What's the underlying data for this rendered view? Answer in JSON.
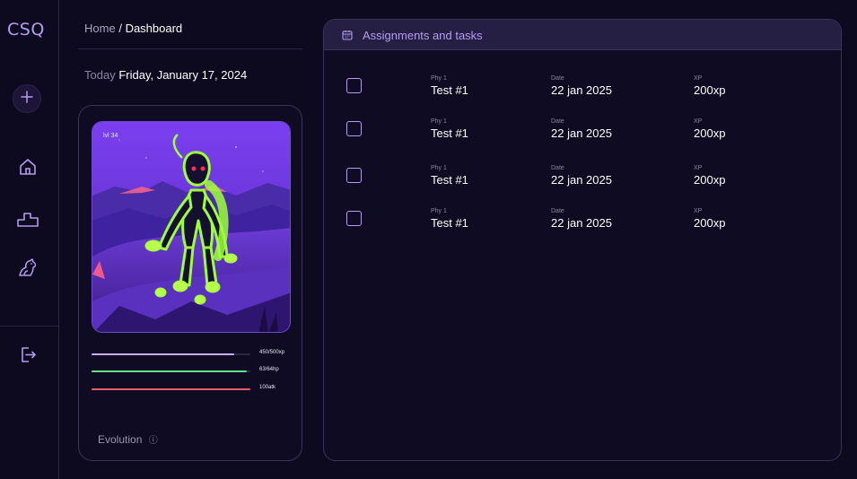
{
  "app": {
    "logo": "CSQ"
  },
  "sidebar": {
    "items": [
      {
        "icon": "plus-icon"
      },
      {
        "icon": "home-icon"
      },
      {
        "icon": "podium-icon"
      },
      {
        "icon": "pet-icon"
      },
      {
        "icon": "logout-icon"
      }
    ]
  },
  "breadcrumb": {
    "home": "Home",
    "separator": "/",
    "current": "Dashboard"
  },
  "today": {
    "label": "Today",
    "value": "Friday, January 17, 2024"
  },
  "pet": {
    "level": "lvl 34",
    "stats": [
      {
        "label": "450/500xp",
        "fraction": 0.9,
        "color": "#c9aef5"
      },
      {
        "label": "63/64hp",
        "fraction": 0.98,
        "color": "#6be08a"
      },
      {
        "label": "100atk",
        "fraction": 1.0,
        "color": "#f25b6a"
      }
    ],
    "evolution_label": "Evolution",
    "evolution_info_icon": "ⓘ"
  },
  "panel": {
    "title": "Assignments and tasks",
    "icon": "calendar-icon",
    "tasks": [
      {
        "subject": "Phy 1",
        "name": "Test #1",
        "date_label": "Date",
        "date": "22 jan 2025",
        "xp_label": "XP",
        "xp": "200xp"
      },
      {
        "subject": "Phy 1",
        "name": "Test #1",
        "date_label": "Date",
        "date": "22 jan 2025",
        "xp_label": "XP",
        "xp": "200xp"
      },
      {
        "subject": "Phy 1",
        "name": "Test #1",
        "date_label": "Date",
        "date": "22 jan 2025",
        "xp_label": "XP",
        "xp": "200xp"
      },
      {
        "subject": "Phy 1",
        "name": "Test #1",
        "date_label": "Date",
        "date": "22 jan 2025",
        "xp_label": "XP",
        "xp": "200xp"
      }
    ]
  },
  "colors": {
    "accent": "#b59cf0",
    "background": "#0d0a1f",
    "panel_header": "#251f44"
  }
}
